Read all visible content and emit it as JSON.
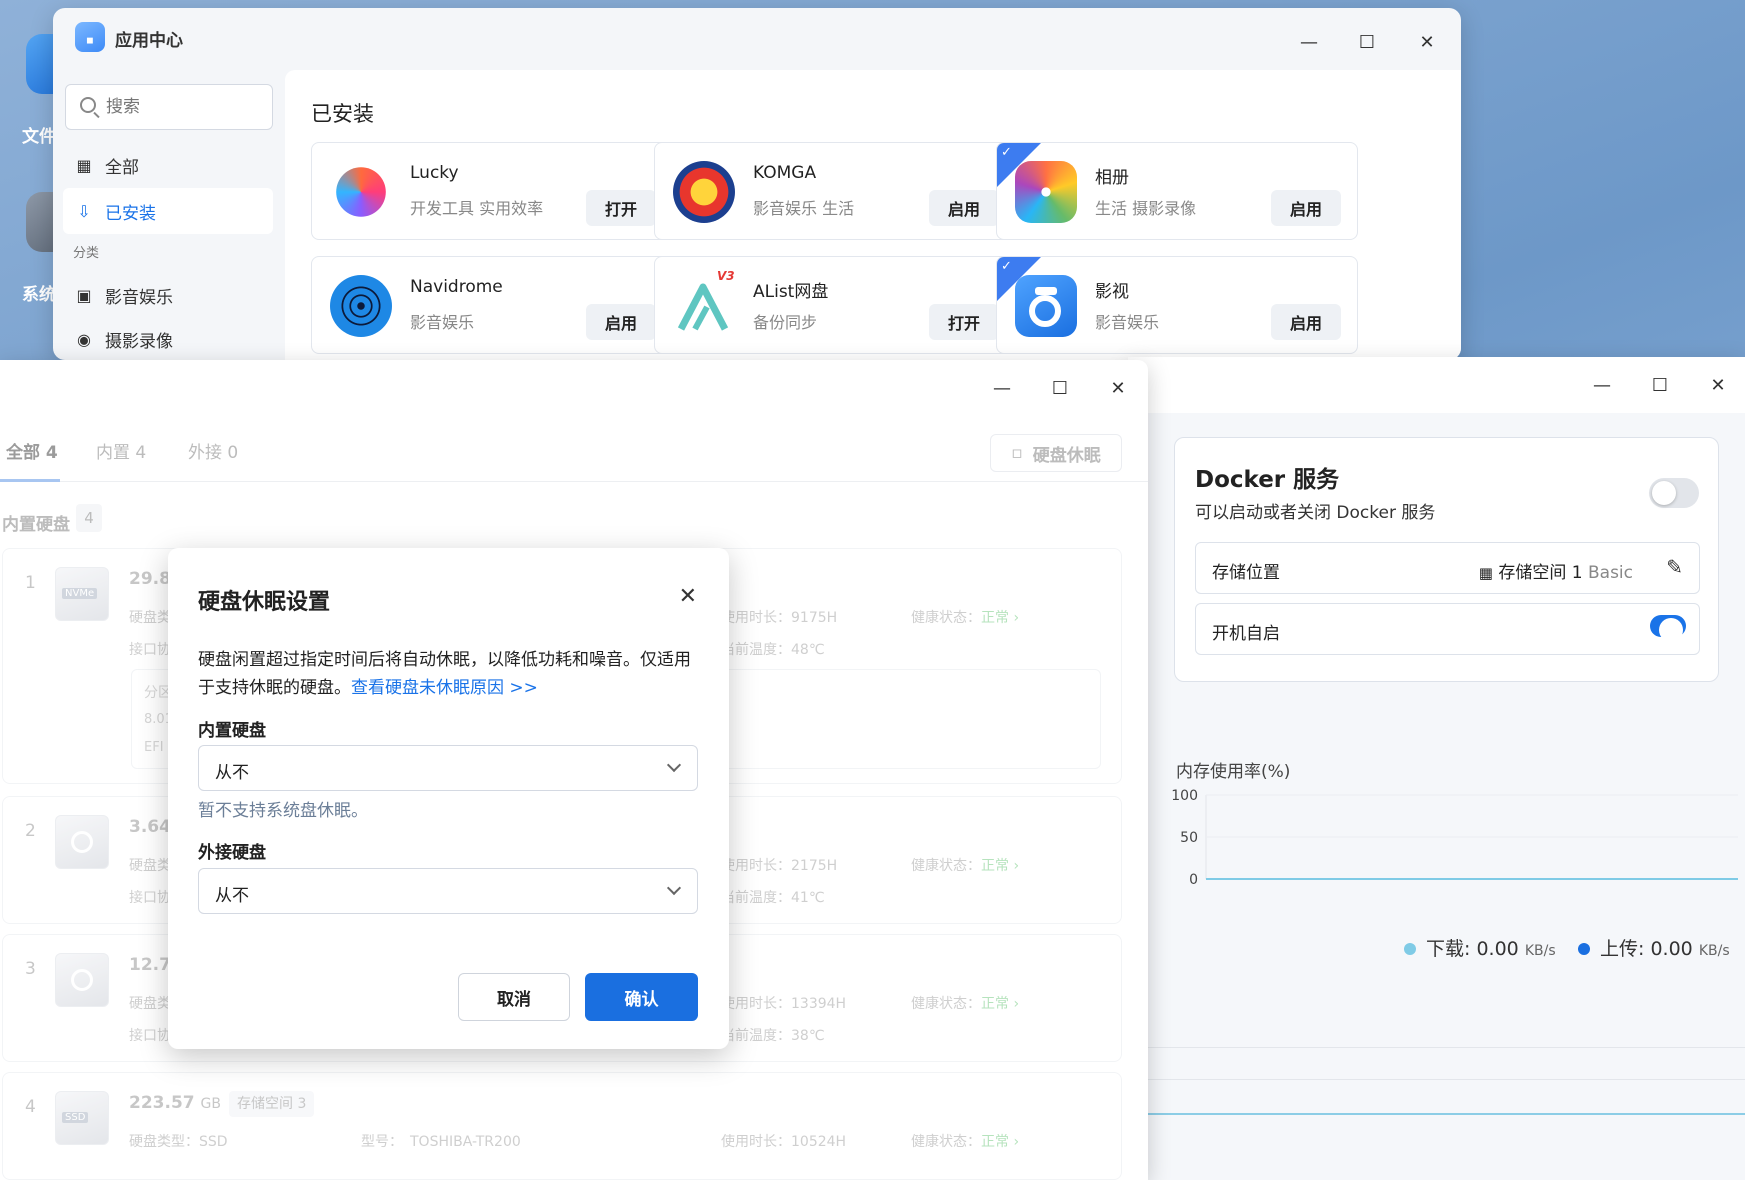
{
  "desktop": {
    "icons": [
      {
        "label": "文件"
      },
      {
        "label": "系统"
      }
    ]
  },
  "app_center": {
    "title": "应用中心",
    "search": {
      "placeholder": "搜索"
    },
    "nav": [
      {
        "label": "全部",
        "icon": "grid-icon"
      },
      {
        "label": "已安装",
        "icon": "installed-icon"
      }
    ],
    "category_label": "分类",
    "categories": [
      {
        "label": "影音娱乐",
        "icon": "video-icon"
      },
      {
        "label": "摄影录像",
        "icon": "camera-icon"
      }
    ],
    "main_title": "已安装",
    "apps": [
      {
        "name": "Lucky",
        "tags": "开发工具 实用效率",
        "button": "打开"
      },
      {
        "name": "KOMGA",
        "tags": "影音娱乐 生活",
        "button": "启用"
      },
      {
        "name": "相册",
        "tags": "生活 摄影录像",
        "button": "启用"
      },
      {
        "name": "Navidrome",
        "tags": "影音娱乐",
        "button": "启用"
      },
      {
        "name": "AList网盘",
        "tags": "备份同步",
        "button": "打开"
      },
      {
        "name": "影视",
        "tags": "影音娱乐",
        "button": "启用"
      }
    ],
    "alist_badge": "V3",
    "colors": {
      "accent": "#1a73e8",
      "official_corner": "#3d7cf0"
    }
  },
  "storage": {
    "tabs": [
      {
        "label": "全部 4"
      },
      {
        "label": "内置 4"
      },
      {
        "label": "外接 0"
      }
    ],
    "sleep_button": "硬盘休眠",
    "section_label": "内置硬盘",
    "section_count": "4",
    "disks": [
      {
        "num": "1",
        "badge": "NVMe",
        "cap": "29.82",
        "unit": "",
        "line2": "硬盘类",
        "line3": "接口协",
        "hours": "使用时长：9175H",
        "temp": "当前温度：48℃",
        "health_label": "健康状态：",
        "health": "正常",
        "partition": {
          "p1": "分区",
          "p2": "8.01",
          "p3": "EFI"
        }
      },
      {
        "num": "2",
        "badge": "",
        "cap": "3.64",
        "unit": "",
        "line2": "硬盘类",
        "line3": "接口协",
        "hours": "使用时长：2175H",
        "temp": "当前温度：41℃",
        "health_label": "健康状态：",
        "health": "正常"
      },
      {
        "num": "3",
        "badge": "",
        "cap": "12.73",
        "unit": "",
        "line2": "硬盘类",
        "line3": "接口协",
        "hours": "使用时长：13394H",
        "temp": "当前温度：38℃",
        "health_label": "健康状态：",
        "health": "正常"
      },
      {
        "num": "4",
        "badge": "SSD",
        "cap": "223.57",
        "unit": "GB",
        "pool": "存储空间 3",
        "line2": "硬盘类型：SSD",
        "model": "型号：　TOSHIBA-TR200",
        "hours": "使用时长：10524H",
        "health_label": "健康状态：",
        "health": "正常"
      }
    ]
  },
  "modal": {
    "title": "硬盘休眠设置",
    "desc": "硬盘闲置超过指定时间后将自动休眠，以降低功耗和噪音。仅适用于支持休眠的硬盘。",
    "link": "查看硬盘未休眠原因 >>",
    "internal_label": "内置硬盘",
    "internal_value": "从不",
    "hint": "暂不支持系统盘休眠。",
    "external_label": "外接硬盘",
    "external_value": "从不",
    "cancel": "取消",
    "confirm": "确认"
  },
  "docker": {
    "title": "Docker 服务",
    "subtitle": "可以启动或者关闭 Docker 服务",
    "service_on": false,
    "storage_label": "存储位置",
    "storage_value": "存储空间 1",
    "storage_type": "Basic",
    "autostart_label": "开机自启",
    "autostart_on": true,
    "mem_title": "内存使用率(%)",
    "mem_ticks": [
      "100",
      "50",
      "0"
    ],
    "download_label": "下载:",
    "download_value": "0.00",
    "upload_label": "上传:",
    "upload_value": "0.00",
    "rate_unit": "KB/s",
    "colors": {
      "download": "#7fcbe6",
      "upload": "#1a6fe0"
    }
  },
  "chart_data": {
    "type": "line",
    "title": "内存使用率(%)",
    "ylim": [
      0,
      100
    ],
    "yticks": [
      100,
      50,
      0
    ],
    "series": [
      {
        "values": [
          0,
          0
        ]
      }
    ],
    "grid": true
  }
}
